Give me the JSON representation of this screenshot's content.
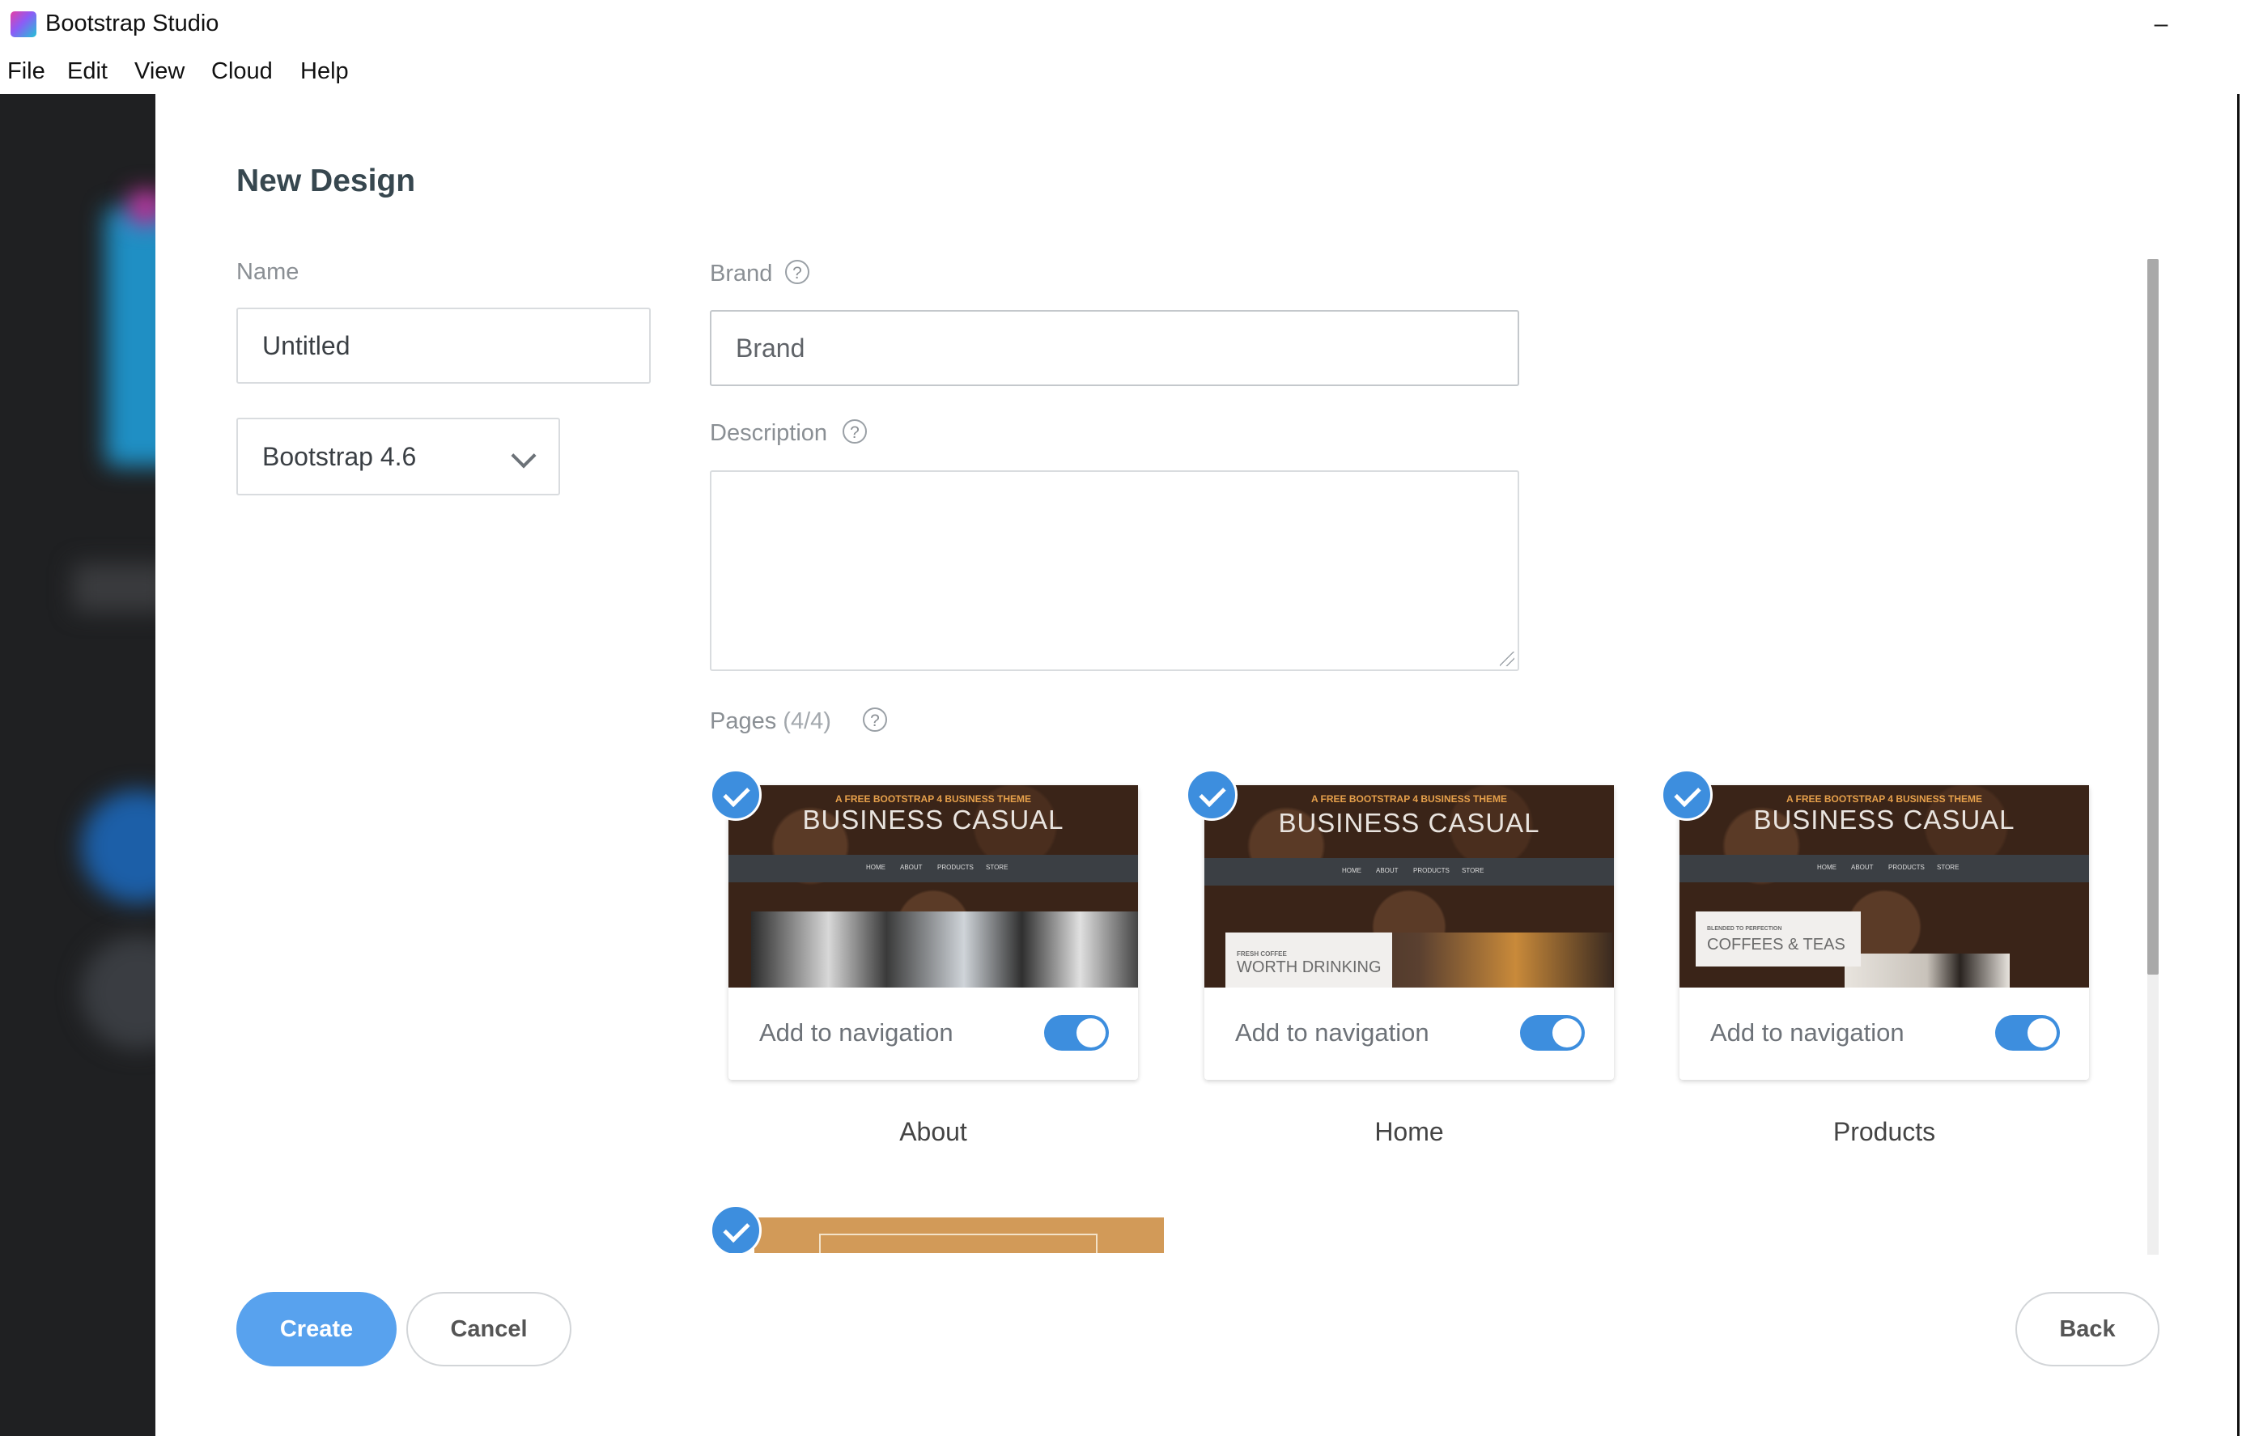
{
  "window": {
    "title": "Bootstrap Studio",
    "minimize_symbol": "–"
  },
  "menu": [
    "File",
    "Edit",
    "View",
    "Cloud",
    "Help"
  ],
  "dialog": {
    "heading": "New Design",
    "name_label": "Name",
    "name_value": "Untitled",
    "framework_value": "Bootstrap 4.6",
    "brand_label": "Brand",
    "brand_value": "Brand",
    "description_label": "Description",
    "description_value": "",
    "help_symbol": "?",
    "pages_label": "Pages",
    "pages_count": "(4/4)",
    "pages": [
      {
        "name": "About",
        "nav_label": "Add to navigation",
        "add_to_navigation": true,
        "selected": true
      },
      {
        "name": "Home",
        "nav_label": "Add to navigation",
        "add_to_navigation": true,
        "selected": true
      },
      {
        "name": "Products",
        "nav_label": "Add to navigation",
        "add_to_navigation": true,
        "selected": true
      }
    ],
    "thumbnail": {
      "tagline": "A FREE BOOTSTRAP 4 BUSINESS THEME",
      "title": "BUSINESS CASUAL",
      "nav_items": [
        "HOME",
        "ABOUT",
        "PRODUCTS",
        "STORE"
      ],
      "home_small": "FRESH COFFEE",
      "home_big": "WORTH DRINKING",
      "products_small": "BLENDED TO PERFECTION",
      "products_big": "COFFEES & TEAS"
    },
    "buttons": {
      "create": "Create",
      "cancel": "Cancel",
      "back": "Back"
    }
  },
  "colors": {
    "accent": "#3d8ede",
    "create_button": "#58a2ee"
  }
}
